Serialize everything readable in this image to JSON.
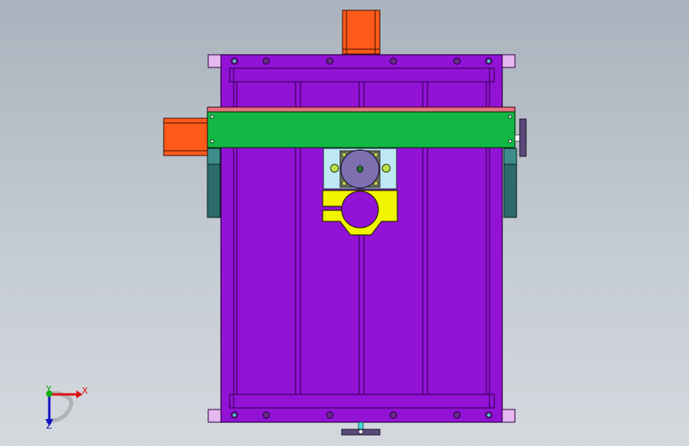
{
  "viewport": {
    "background_top": "#a9b3bd",
    "background_bottom": "#d4d9de"
  },
  "model": {
    "frame_color": "#9212d6",
    "frame_edge": "#2a0040",
    "corner_pad_color": "#e6b8f0",
    "gantry_beam_color": "#11b944",
    "beam_top_strip_color": "#e8737e",
    "motor_color": "#ff5a1a",
    "spindle_bracket_color": "#f2f500",
    "spindle_color": "#7e6fb0",
    "mount_plate_color": "#bfe8f5",
    "side_block_color": "#2b6b6a",
    "handwheel_color": "#5a4a7a"
  },
  "triad": {
    "x_label": "X",
    "y_label": "Y",
    "z_label": "Z",
    "x_color": "#e01010",
    "y_color": "#10b010",
    "z_color": "#1010c0"
  }
}
